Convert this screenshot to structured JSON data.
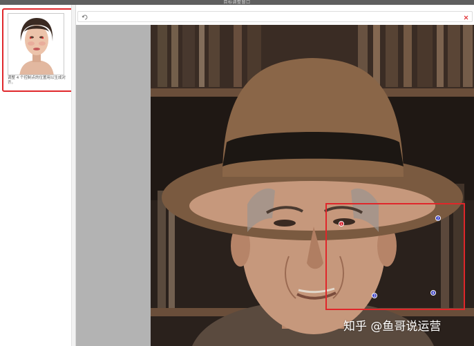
{
  "window": {
    "title": "目标调整窗口"
  },
  "sidebar": {
    "thumbnail": {
      "caption": "调整 4 个控制点的位置用以生成对齐。"
    }
  },
  "toolbar": {
    "left_icon": "rotate-icon",
    "right_icon": "close-icon"
  },
  "photo": {
    "control_points": [
      {
        "label": "1",
        "color": "#d91d2a"
      },
      {
        "label": "2",
        "color": "#3a3fc2"
      },
      {
        "label": "3",
        "color": "#3a3fc2"
      },
      {
        "label": "4",
        "color": "#3a3fc2"
      }
    ]
  },
  "watermark": {
    "text": "知乎 @鱼哥说运营"
  },
  "colors": {
    "highlight": "#e0262a",
    "titlebar": "#5f5f5f",
    "canvas_bg": "#b3b3b3"
  }
}
